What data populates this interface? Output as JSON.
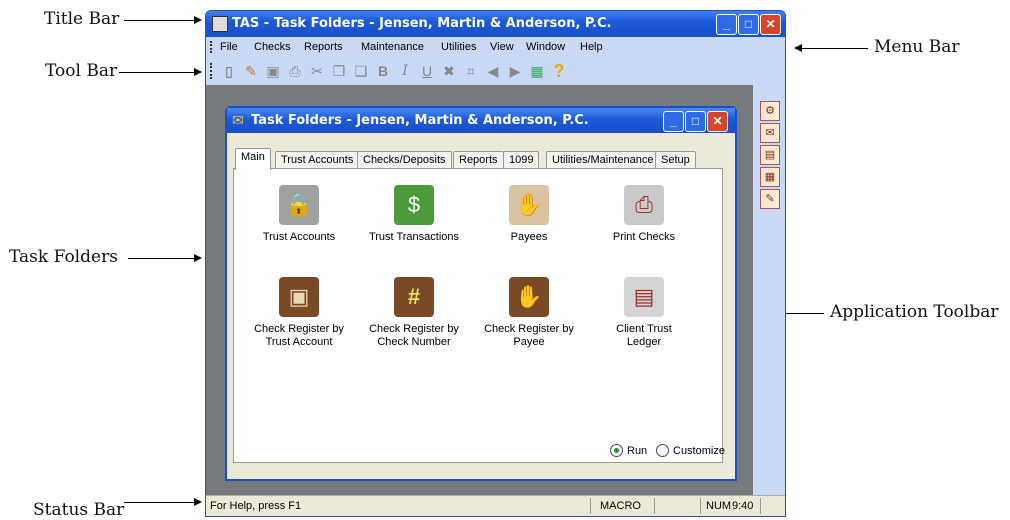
{
  "callouts": {
    "title_bar": "Title Bar",
    "tool_bar": "Tool Bar",
    "task_folders": "Task Folders",
    "status_bar": "Status Bar",
    "menu_bar": "Menu Bar",
    "application_toolbar": "Application Toolbar"
  },
  "app": {
    "title": "TAS - Task Folders - Jensen, Martin & Anderson, P.C.",
    "window_buttons": {
      "minimize": "_",
      "maximize": "□",
      "close": "✕"
    }
  },
  "menu": [
    "File",
    "Checks",
    "Reports",
    "Maintenance",
    "Utilities",
    "View",
    "Window",
    "Help"
  ],
  "toolbar_icons": [
    "new-icon",
    "open-icon",
    "save-icon",
    "print-preview-icon",
    "cut-icon",
    "copy-icon",
    "paste-icon",
    "bold-icon",
    "italic-icon",
    "underline-icon",
    "delete-icon",
    "properties-icon",
    "back-icon",
    "forward-icon",
    "calendar-icon",
    "help-icon"
  ],
  "toolbar_glyphs": [
    "▯",
    "✎",
    "▣",
    "⎙",
    "✂",
    "❐",
    "❑",
    "B",
    "I",
    "U",
    "✖",
    "⌗",
    "◀",
    "▶",
    "▦",
    "?"
  ],
  "application_toolbar_icons": [
    "checks-icon",
    "folder-icon",
    "register-icon",
    "ledger-icon",
    "reports-icon"
  ],
  "application_toolbar_glyphs": [
    "⚙",
    "✉",
    "▤",
    "▦",
    "✎"
  ],
  "task_window": {
    "title": "Task Folders - Jensen, Martin & Anderson, P.C.",
    "tabs": [
      "Main",
      "Trust Accounts",
      "Checks/Deposits",
      "Reports",
      "1099",
      "Utilities/Maintenance",
      "Setup"
    ],
    "active_tab": "Main",
    "tasks": [
      {
        "label": "Trust Accounts",
        "icon": "safe-icon",
        "glyph": "🔒"
      },
      {
        "label": "Trust Transactions",
        "icon": "safe-money-icon",
        "glyph": "$"
      },
      {
        "label": "Payees",
        "icon": "payee-hand-icon",
        "glyph": "✋"
      },
      {
        "label": "Print Checks",
        "icon": "printer-icon",
        "glyph": "⎙"
      },
      {
        "label": "Check Register by Trust Account",
        "icon": "register-safe-icon",
        "glyph": "▣"
      },
      {
        "label": "Check Register by Check Number",
        "icon": "register-number-icon",
        "glyph": "#"
      },
      {
        "label": "Check Register by Payee",
        "icon": "register-payee-icon",
        "glyph": "✋"
      },
      {
        "label": "Client Trust Ledger",
        "icon": "ledger-safe-icon",
        "glyph": "▤"
      }
    ],
    "mode_options": [
      "Run",
      "Customize"
    ],
    "selected_mode": "Run"
  },
  "status": {
    "help_text": "For Help, press F1",
    "macro": "MACRO",
    "num": "NUM",
    "time": "9:40"
  }
}
